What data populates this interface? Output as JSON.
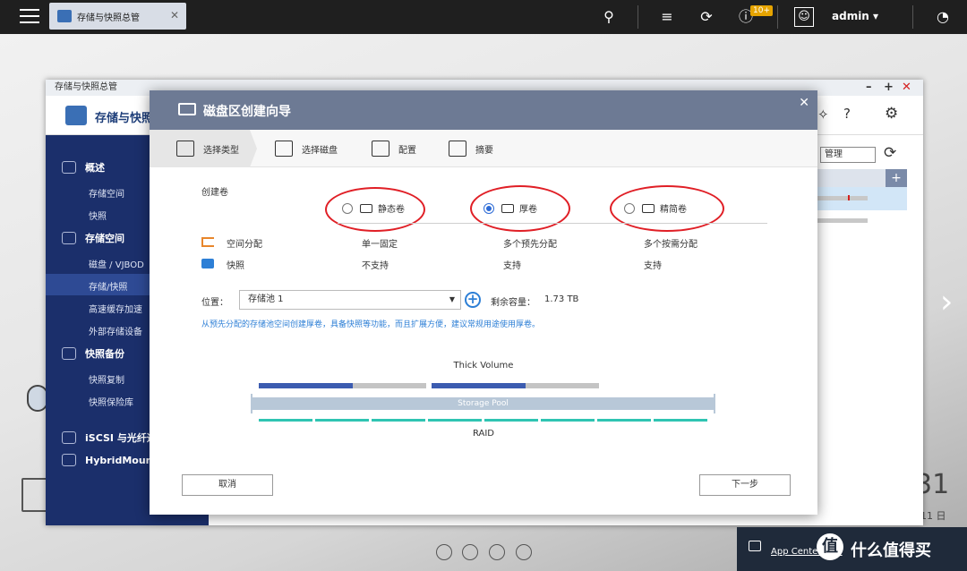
{
  "topbar": {
    "task_tab_label": "存储与快照总管",
    "notification_count": "10+",
    "user": "admin ▾"
  },
  "app": {
    "window_title": "存储与快照总管",
    "name": "存储与快照",
    "manage_label": "管理",
    "sidebar": {
      "overview": "概述",
      "overview_items": [
        "存储空间",
        "快照"
      ],
      "storage": "存储空间",
      "storage_items": [
        "磁盘 / VJBOD",
        "存储/快照",
        "高速缓存加速",
        "外部存储设备"
      ],
      "snapshot_backup": "快照备份",
      "snapshot_items": [
        "快照复制",
        "快照保险库"
      ],
      "iscsi": "iSCSI 与光纤通",
      "hybridmount": "HybridMount"
    }
  },
  "wizard": {
    "title": "磁盘区创建向导",
    "steps": [
      "选择类型",
      "选择磁盘",
      "配置",
      "摘要"
    ],
    "create_label": "创建卷",
    "options": [
      {
        "label": "静态卷",
        "selected": false
      },
      {
        "label": "厚卷",
        "selected": true
      },
      {
        "label": "精简卷",
        "selected": false
      }
    ],
    "features": [
      {
        "name": "空间分配",
        "icon": "space-allocation-icon",
        "values": [
          "单一固定",
          "多个预先分配",
          "多个按需分配"
        ]
      },
      {
        "name": "快照",
        "icon": "snapshot-icon",
        "values": [
          "不支持",
          "支持",
          "支持"
        ]
      }
    ],
    "location_label": "位置：",
    "location_value": "存储池 1",
    "free_label": "剩余容量：",
    "free_value": "1.73 TB",
    "hint": "从预先分配的存储池空间创建厚卷，具备快照等功能，而且扩展方便，建议常规用途使用厚卷。",
    "diagram": {
      "title": "Thick Volume",
      "pool_label": "Storage Pool",
      "raid_label": "RAID",
      "volume_fill": [
        0.56,
        0.56
      ]
    },
    "cancel": "取消",
    "next": "下一步"
  },
  "desktop": {
    "clock_digits": "31",
    "clock_date": "11 日",
    "notification_text": "App Center 更新",
    "watermark": "什么值得买",
    "watermark_logo": "值"
  },
  "colors": {
    "topbar": "#1f1f1f",
    "sidebar": "#1b2f6b",
    "wizard_header": "#6d7a94",
    "accent_blue": "#2d6bd6",
    "annotation_red": "#e01f26",
    "raid_teal": "#2fc4b2",
    "volume_blue": "#3c5cb0"
  }
}
